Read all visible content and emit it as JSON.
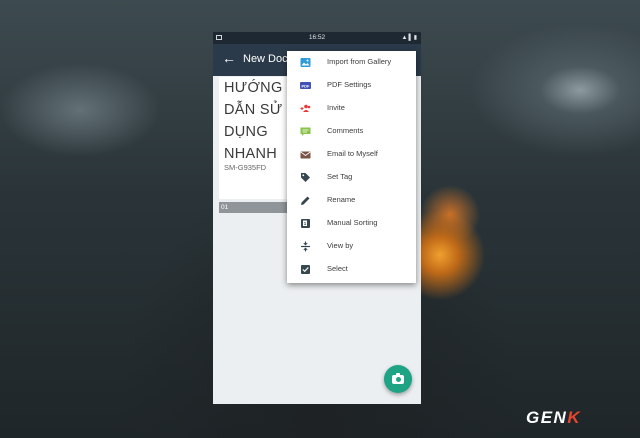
{
  "status_bar": {
    "time": "16:52",
    "system_icons": "wifi-signal-battery"
  },
  "app_bar": {
    "back_icon": "arrow-left-icon",
    "title": "New Doc 2"
  },
  "document": {
    "preview_lines": [
      "HƯỚNG",
      "DẪN SỬ",
      "DỤNG",
      "NHANH"
    ],
    "preview_subtitle": "SM-G935FD",
    "page_count": "01"
  },
  "menu": {
    "items": [
      {
        "label": "Import from Gallery",
        "icon": "gallery-icon",
        "color": "#2e9bd6"
      },
      {
        "label": "PDF Settings",
        "icon": "pdf-icon",
        "color": "#3f51b5"
      },
      {
        "label": "Invite",
        "icon": "invite-icon",
        "color": "#e53935"
      },
      {
        "label": "Comments",
        "icon": "comments-icon",
        "color": "#8bc34a"
      },
      {
        "label": "Email to Myself",
        "icon": "email-icon",
        "color": "#795548"
      },
      {
        "label": "Set Tag",
        "icon": "tag-icon",
        "color": "#37474f"
      },
      {
        "label": "Rename",
        "icon": "pencil-icon",
        "color": "#37474f"
      },
      {
        "label": "Manual Sorting",
        "icon": "sort-icon",
        "color": "#37474f"
      },
      {
        "label": "View by",
        "icon": "view-by-icon",
        "color": "#37474f"
      },
      {
        "label": "Select",
        "icon": "checkbox-icon",
        "color": "#37474f"
      }
    ]
  },
  "fab": {
    "icon": "camera-icon",
    "color": "#1fa385"
  },
  "watermark": {
    "text": "GENK"
  }
}
